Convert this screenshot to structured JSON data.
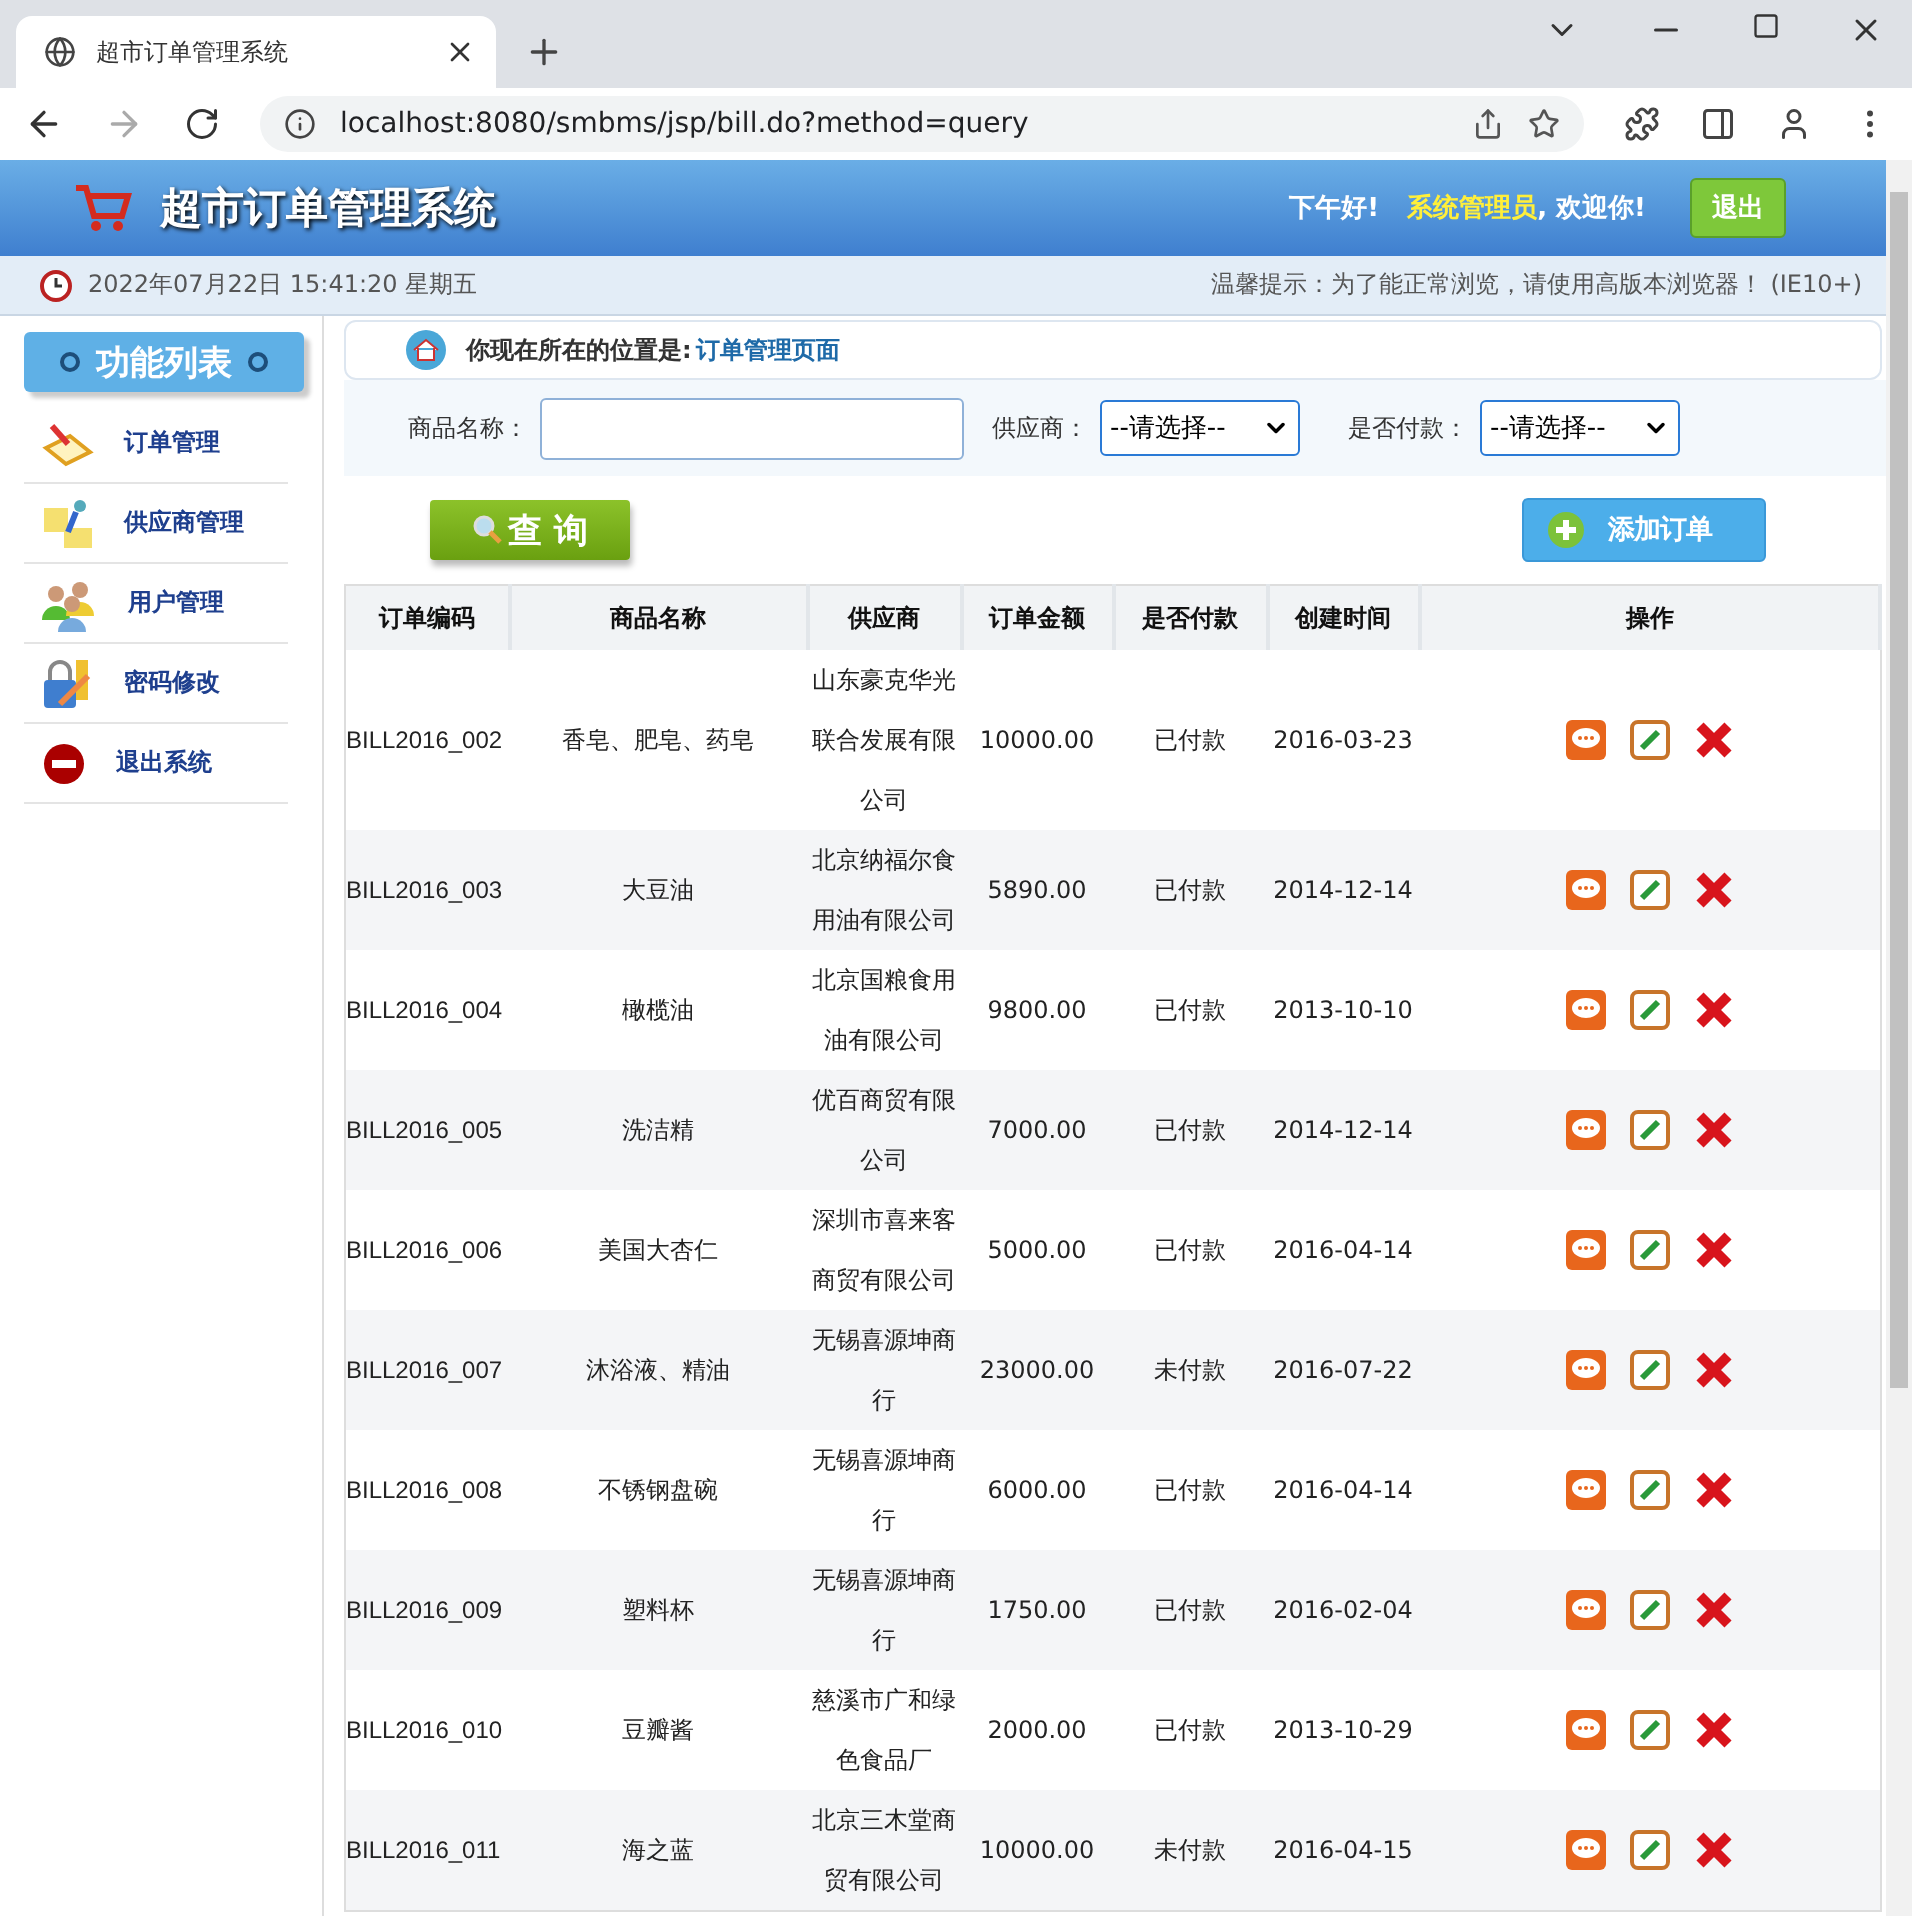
{
  "browser": {
    "tab_title": "超市订单管理系统",
    "url": "localhost:8080/smbms/jsp/bill.do?method=query"
  },
  "header": {
    "title": "超市订单管理系统",
    "greeting": "下午好!",
    "user": "系统管理员",
    "welcome": ", 欢迎你!",
    "logout": "退出"
  },
  "info_bar": {
    "datetime": "2022年07月22日 15:41:20 星期五",
    "notice": "温馨提示：为了能正常浏览，请使用高版本浏览器！ (IE10+)"
  },
  "sidebar": {
    "heading": "功能列表",
    "items": [
      {
        "label": "订单管理",
        "kind": "order"
      },
      {
        "label": "供应商管理",
        "kind": "provider"
      },
      {
        "label": "用户管理",
        "kind": "user"
      },
      {
        "label": "密码修改",
        "kind": "password"
      },
      {
        "label": "退出系统",
        "kind": "exit"
      }
    ]
  },
  "breadcrumb": {
    "prefix": "你现在所在的位置是:",
    "location": "订单管理页面"
  },
  "filters": [
    {
      "label": "商品名称：",
      "kind": "text"
    },
    {
      "label": "供应商：",
      "kind": "select",
      "value": "--请选择--"
    },
    {
      "label": "是否付款：",
      "kind": "select",
      "value": "--请选择--"
    }
  ],
  "query_button": "查 询",
  "add_button": "添加订单",
  "table": {
    "columns": [
      "订单编码",
      "商品名称",
      "供应商",
      "订单金额",
      "是否付款",
      "创建时间",
      "操作"
    ],
    "rows": [
      {
        "cells": [
          "BILL2016_002",
          "香皂、肥皂、药皂",
          "山东豪克华光联合发展有限公司",
          "10000.00",
          "已付款",
          "2016-03-23"
        ]
      },
      {
        "cells": [
          "BILL2016_003",
          "大豆油",
          "北京纳福尔食用油有限公司",
          "5890.00",
          "已付款",
          "2014-12-14"
        ]
      },
      {
        "cells": [
          "BILL2016_004",
          "橄榄油",
          "北京国粮食用油有限公司",
          "9800.00",
          "已付款",
          "2013-10-10"
        ]
      },
      {
        "cells": [
          "BILL2016_005",
          "洗洁精",
          "优百商贸有限公司",
          "7000.00",
          "已付款",
          "2014-12-14"
        ]
      },
      {
        "cells": [
          "BILL2016_006",
          "美国大杏仁",
          "深圳市喜来客商贸有限公司",
          "5000.00",
          "已付款",
          "2016-04-14"
        ]
      },
      {
        "cells": [
          "BILL2016_007",
          "沐浴液、精油",
          "无锡喜源坤商行",
          "23000.00",
          "未付款",
          "2016-07-22"
        ]
      },
      {
        "cells": [
          "BILL2016_008",
          "不锈钢盘碗",
          "无锡喜源坤商行",
          "6000.00",
          "已付款",
          "2016-04-14"
        ]
      },
      {
        "cells": [
          "BILL2016_009",
          "塑料杯",
          "无锡喜源坤商行",
          "1750.00",
          "已付款",
          "2016-02-04"
        ]
      },
      {
        "cells": [
          "BILL2016_010",
          "豆瓣酱",
          "慈溪市广和绿色食品厂",
          "2000.00",
          "已付款",
          "2013-10-29"
        ]
      },
      {
        "cells": [
          "BILL2016_011",
          "海之蓝",
          "北京三木堂商贸有限公司",
          "10000.00",
          "未付款",
          "2016-04-15"
        ]
      }
    ]
  }
}
